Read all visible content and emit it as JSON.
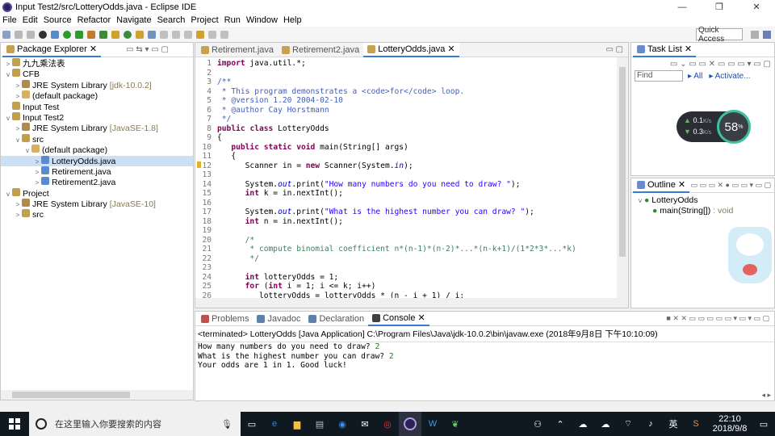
{
  "window": {
    "title": "Input Test2/src/LotteryOdds.java - Eclipse IDE",
    "min": "—",
    "max": "❐",
    "close": "✕"
  },
  "menu": [
    "File",
    "Edit",
    "Source",
    "Refactor",
    "Navigate",
    "Search",
    "Project",
    "Run",
    "Window",
    "Help"
  ],
  "toolbar": {
    "quick_access": "Quick Access"
  },
  "package_explorer": {
    "tab": "Package Explorer",
    "items": [
      {
        "indent": 0,
        "arrow": ">",
        "label": "九九乘法表",
        "extra": ""
      },
      {
        "indent": 0,
        "arrow": "v",
        "label": "CFB",
        "extra": ""
      },
      {
        "indent": 1,
        "arrow": ">",
        "label": "JRE System Library",
        "extra": "[jdk-10.0.2]"
      },
      {
        "indent": 1,
        "arrow": ">",
        "label": "(default package)",
        "extra": ""
      },
      {
        "indent": 0,
        "arrow": "",
        "label": "Input Test",
        "extra": ""
      },
      {
        "indent": 0,
        "arrow": "v",
        "label": "Input Test2",
        "extra": ""
      },
      {
        "indent": 1,
        "arrow": ">",
        "label": "JRE System Library",
        "extra": "[JavaSE-1.8]"
      },
      {
        "indent": 1,
        "arrow": "v",
        "label": "src",
        "extra": ""
      },
      {
        "indent": 2,
        "arrow": "v",
        "label": "(default package)",
        "extra": ""
      },
      {
        "indent": 3,
        "arrow": ">",
        "label": "LotteryOdds.java",
        "extra": ""
      },
      {
        "indent": 3,
        "arrow": ">",
        "label": "Retirement.java",
        "extra": ""
      },
      {
        "indent": 3,
        "arrow": ">",
        "label": "Retirement2.java",
        "extra": ""
      },
      {
        "indent": 0,
        "arrow": "v",
        "label": "Project",
        "extra": ""
      },
      {
        "indent": 1,
        "arrow": ">",
        "label": "JRE System Library",
        "extra": "[JavaSE-10]"
      },
      {
        "indent": 1,
        "arrow": ">",
        "label": "src",
        "extra": ""
      }
    ]
  },
  "editor": {
    "tabs": [
      "Retirement.java",
      "Retirement2.java",
      "LotteryOdds.java"
    ],
    "lines": [
      {
        "n": "1",
        "code": "import java.util.*;"
      },
      {
        "n": "2",
        "code": ""
      },
      {
        "n": "3",
        "code": "/**"
      },
      {
        "n": "4",
        "code": " * This program demonstrates a <code>for</code> loop."
      },
      {
        "n": "5",
        "code": " * @version 1.20 2004-02-10"
      },
      {
        "n": "6",
        "code": " * @author Cay Horstmann"
      },
      {
        "n": "7",
        "code": " */"
      },
      {
        "n": "8",
        "code": "public class LotteryOdds"
      },
      {
        "n": "9",
        "code": "{"
      },
      {
        "n": "10",
        "code": "   public static void main(String[] args)"
      },
      {
        "n": "11",
        "code": "   {"
      },
      {
        "n": "12",
        "code": "      Scanner in = new Scanner(System.in);"
      },
      {
        "n": "13",
        "code": ""
      },
      {
        "n": "14",
        "code": "      System.out.print(\"How many numbers do you need to draw? \");"
      },
      {
        "n": "15",
        "code": "      int k = in.nextInt();"
      },
      {
        "n": "16",
        "code": ""
      },
      {
        "n": "17",
        "code": "      System.out.print(\"What is the highest number you can draw? \");"
      },
      {
        "n": "18",
        "code": "      int n = in.nextInt();"
      },
      {
        "n": "19",
        "code": ""
      },
      {
        "n": "20",
        "code": "      /*"
      },
      {
        "n": "21",
        "code": "       * compute binomial coefficient n*(n-1)*(n-2)*...*(n-k+1)/(1*2*3*...*k)"
      },
      {
        "n": "22",
        "code": "       */"
      },
      {
        "n": "23",
        "code": ""
      },
      {
        "n": "24",
        "code": "      int lotteryOdds = 1;"
      },
      {
        "n": "25",
        "code": "      for (int i = 1; i <= k; i++)"
      },
      {
        "n": "26",
        "code": "         lotteryOdds = lotteryOdds * (n - i + 1) / i;"
      }
    ]
  },
  "task_list": {
    "tab": "Task List",
    "find_placeholder": "Find",
    "all": "All",
    "activate": "Activate..."
  },
  "net_widget": {
    "up": "0.1",
    "up_unit": "K/s",
    "down": "0.3",
    "down_unit": "K/s",
    "percent": "58",
    "percent_sign": "%"
  },
  "outline": {
    "tab": "Outline",
    "class": "LotteryOdds",
    "method": "main(String[])",
    "method_type": " : void"
  },
  "console": {
    "tabs": [
      "Problems",
      "Javadoc",
      "Declaration",
      "Console"
    ],
    "header": "<terminated> LotteryOdds [Java Application] C:\\Program Files\\Java\\jdk-10.0.2\\bin\\javaw.exe (2018年9月8日 下午10:10:09)",
    "out": [
      {
        "text": "How many numbers do you need to draw? ",
        "input": "2"
      },
      {
        "text": "What is the highest number you can draw? ",
        "input": "2"
      },
      {
        "text": "Your odds are 1 in 1. Good luck!",
        "input": ""
      }
    ]
  },
  "taskbar": {
    "search_placeholder": "在这里输入你要搜索的内容",
    "ime": "英",
    "time": "22:10",
    "date": "2018/9/8"
  }
}
